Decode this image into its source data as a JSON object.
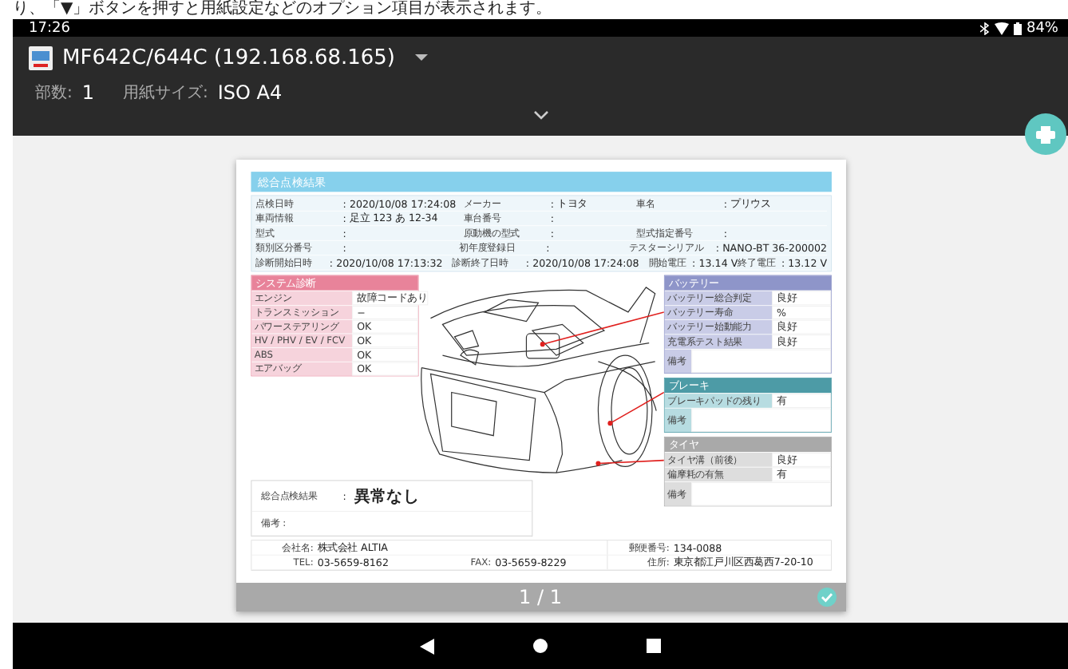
{
  "caption": "り、「▼」ボタンを押すと用紙設定などのオプション項目が表示されます。",
  "status_bar": {
    "time": "17:26",
    "battery": "84%"
  },
  "printer": {
    "name": "MF642C/644C (192.168.68.165)",
    "copies_label": "部数:",
    "copies": "1",
    "paper_label": "用紙サイズ:",
    "paper": "ISO A4"
  },
  "report": {
    "title": "総合点検結果",
    "info_rows": [
      [
        {
          "label": "点検日時",
          "colon": ":",
          "value": "2020/10/08 17:24:08"
        },
        {
          "label": "メーカー",
          "colon": ":",
          "value": "トヨタ"
        },
        {
          "label": "車名",
          "colon": ":",
          "value": "プリウス"
        }
      ],
      [
        {
          "label": "車両情報",
          "colon": ":",
          "value": "足立 123 あ 12-34"
        },
        {
          "label": "車台番号",
          "colon": ":"
        }
      ],
      [
        {
          "label": "型式",
          "colon": ":"
        },
        {
          "label": "原動機の型式",
          "colon": ":"
        },
        {
          "label": "型式指定番号",
          "colon": ":"
        }
      ],
      [
        {
          "label": "類別区分番号",
          "colon": ":"
        },
        {
          "label": "初年度登録日",
          "colon": ":"
        },
        {
          "label": "テスターシリアル",
          "colon": ":",
          "value": "NANO-BT 36-200002"
        }
      ],
      [
        {
          "label": "診断開始日時",
          "colon": ":",
          "value": "2020/10/08 17:13:32"
        },
        {
          "label": "診断終了日時",
          "colon": ":",
          "value": "2020/10/08 17:24:08"
        },
        {
          "label": "開始電圧",
          "colon": ":",
          "value": "13.14 V"
        },
        {
          "label": "終了電圧",
          "colon": ":",
          "value": "13.12 V"
        }
      ]
    ],
    "system": {
      "title": "システム診断",
      "color": "#e8839a",
      "rows": [
        {
          "label": "エンジン",
          "value": "故障コードあり"
        },
        {
          "label": "トランスミッション",
          "value": "−"
        },
        {
          "label": "パワーステアリング",
          "value": "OK"
        },
        {
          "label": "HV / PHV / EV / FCV",
          "value": "OK"
        },
        {
          "label": "ABS",
          "value": "OK"
        },
        {
          "label": "エアバッグ",
          "value": "OK"
        }
      ]
    },
    "panels": [
      {
        "title": "バッテリー",
        "color": "#8e95c9",
        "rows": [
          {
            "label": "バッテリー総合判定",
            "value": "良好"
          },
          {
            "label": "バッテリー寿命",
            "value": "%"
          },
          {
            "label": "バッテリー始動能力",
            "value": "良好"
          },
          {
            "label": "充電系テスト結果",
            "value": "良好"
          }
        ],
        "note_label": "備考"
      },
      {
        "title": "ブレーキ",
        "color": "#4d9ba6",
        "rows": [
          {
            "label": "ブレーキパッドの残り",
            "value": "有"
          }
        ],
        "note_label": "備考"
      },
      {
        "title": "タイヤ",
        "color": "#a9a9a9",
        "rows": [
          {
            "label": "タイヤ溝（前後）",
            "value": "良好"
          },
          {
            "label": "偏摩耗の有無",
            "value": "有"
          }
        ],
        "note_label": "備考"
      }
    ],
    "result": {
      "label": "総合点検結果",
      "colon": ":",
      "value": "異常なし",
      "note_label": "備考 :"
    },
    "footer_rows": [
      [
        {
          "label": "会社名:",
          "value": "株式会社 ALTIA"
        },
        {
          "label": "郵便番号:",
          "value": "134-0088"
        }
      ],
      [
        {
          "label": "TEL:",
          "value": "03-5659-8162"
        },
        {
          "label": "FAX:",
          "value": "03-5659-8229"
        },
        {
          "label": "住所:",
          "value": "東京都江戸川区西葛西7-20-10"
        }
      ]
    ]
  },
  "pager": "1 / 1"
}
